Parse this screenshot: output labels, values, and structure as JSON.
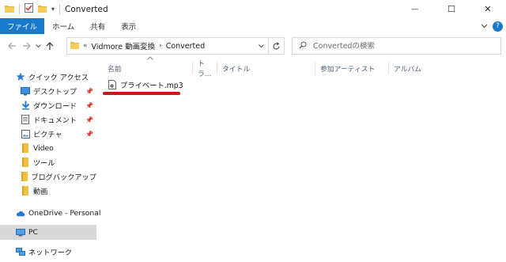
{
  "window": {
    "title": "Converted",
    "buttons": {
      "minimize": "—",
      "maximize": "☐",
      "close": "✕"
    }
  },
  "quick_access_toolbar": {
    "dropdown_glyph": "▾"
  },
  "ribbon": {
    "tabs": [
      "ファイル",
      "ホーム",
      "共有",
      "表示"
    ],
    "help_glyph": "?"
  },
  "address": {
    "overflow": "«",
    "crumbs": [
      "Vidmore 動画変換",
      "Converted"
    ],
    "separator": "›"
  },
  "search": {
    "placeholder": "Convertedの検索"
  },
  "nav_pane": {
    "quick_access": "クイック アクセス",
    "items": [
      {
        "label": "デスクトップ",
        "icon": "desktop-icon",
        "pinned": true
      },
      {
        "label": "ダウンロード",
        "icon": "download-icon",
        "pinned": true
      },
      {
        "label": "ドキュメント",
        "icon": "document-icon",
        "pinned": true
      },
      {
        "label": "ピクチャ",
        "icon": "picture-icon",
        "pinned": true
      },
      {
        "label": "Video",
        "icon": "folder-icon",
        "pinned": false
      },
      {
        "label": "ツール",
        "icon": "folder-icon",
        "pinned": false
      },
      {
        "label": "ブログバックアップ",
        "icon": "folder-icon",
        "pinned": false
      },
      {
        "label": "動画",
        "icon": "folder-icon",
        "pinned": false
      }
    ],
    "onedrive": "OneDrive - Personal",
    "pc": "PC",
    "network": "ネットワーク"
  },
  "columns": [
    "名前",
    "トラ...",
    "タイトル",
    "参加アーティスト",
    "アルバム"
  ],
  "files": [
    {
      "name": "プライベート.mp3",
      "icon": "audio-file-icon"
    }
  ],
  "colors": {
    "file_tab": "#1979ca",
    "folder": "#e8b83c",
    "highlight_underline": "#c8171d",
    "selected_nav": "#d9d9d9"
  }
}
